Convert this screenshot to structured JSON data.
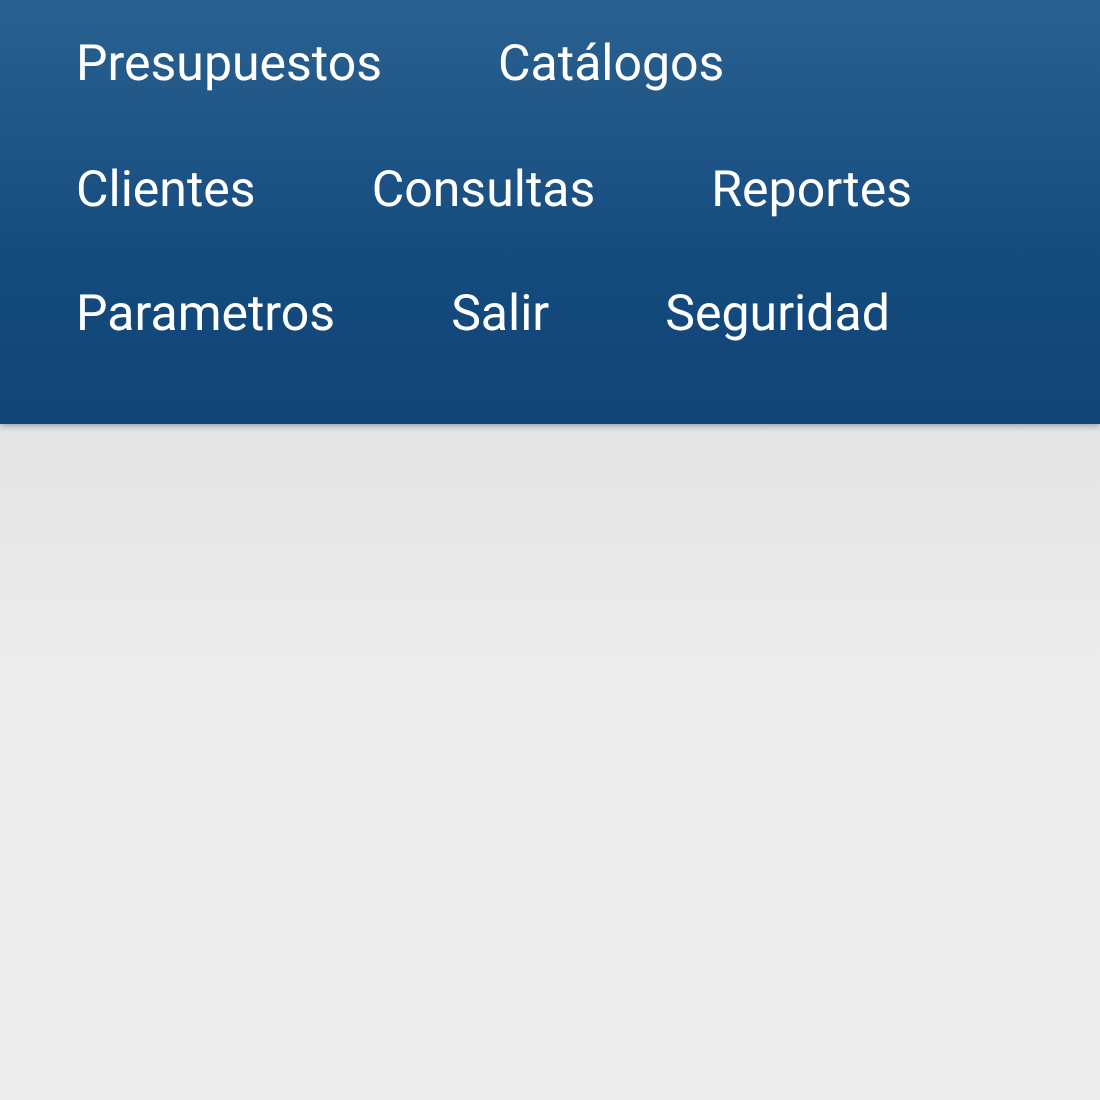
{
  "menu": {
    "rows": [
      {
        "items": [
          {
            "label": "Presupuestos"
          },
          {
            "label": "Catálogos"
          }
        ]
      },
      {
        "items": [
          {
            "label": "Clientes"
          },
          {
            "label": "Consultas"
          },
          {
            "label": "Reportes"
          }
        ]
      },
      {
        "items": [
          {
            "label": "Parametros"
          },
          {
            "label": "Salir"
          },
          {
            "label": "Seguridad"
          }
        ]
      }
    ]
  }
}
